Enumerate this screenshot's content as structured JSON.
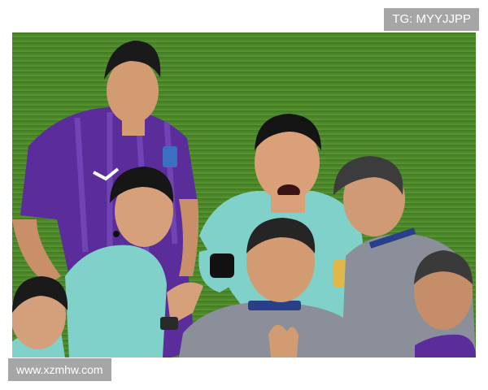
{
  "watermarks": {
    "top_right": "TG: MYYJJPP",
    "bottom_left": "www.xzmhw.com"
  },
  "colors": {
    "pitch": "#4f8a2c",
    "purple_kit": "#5b2d9a",
    "referee_kit": "#7fd1c9",
    "official_grey": "#8a8f99"
  }
}
